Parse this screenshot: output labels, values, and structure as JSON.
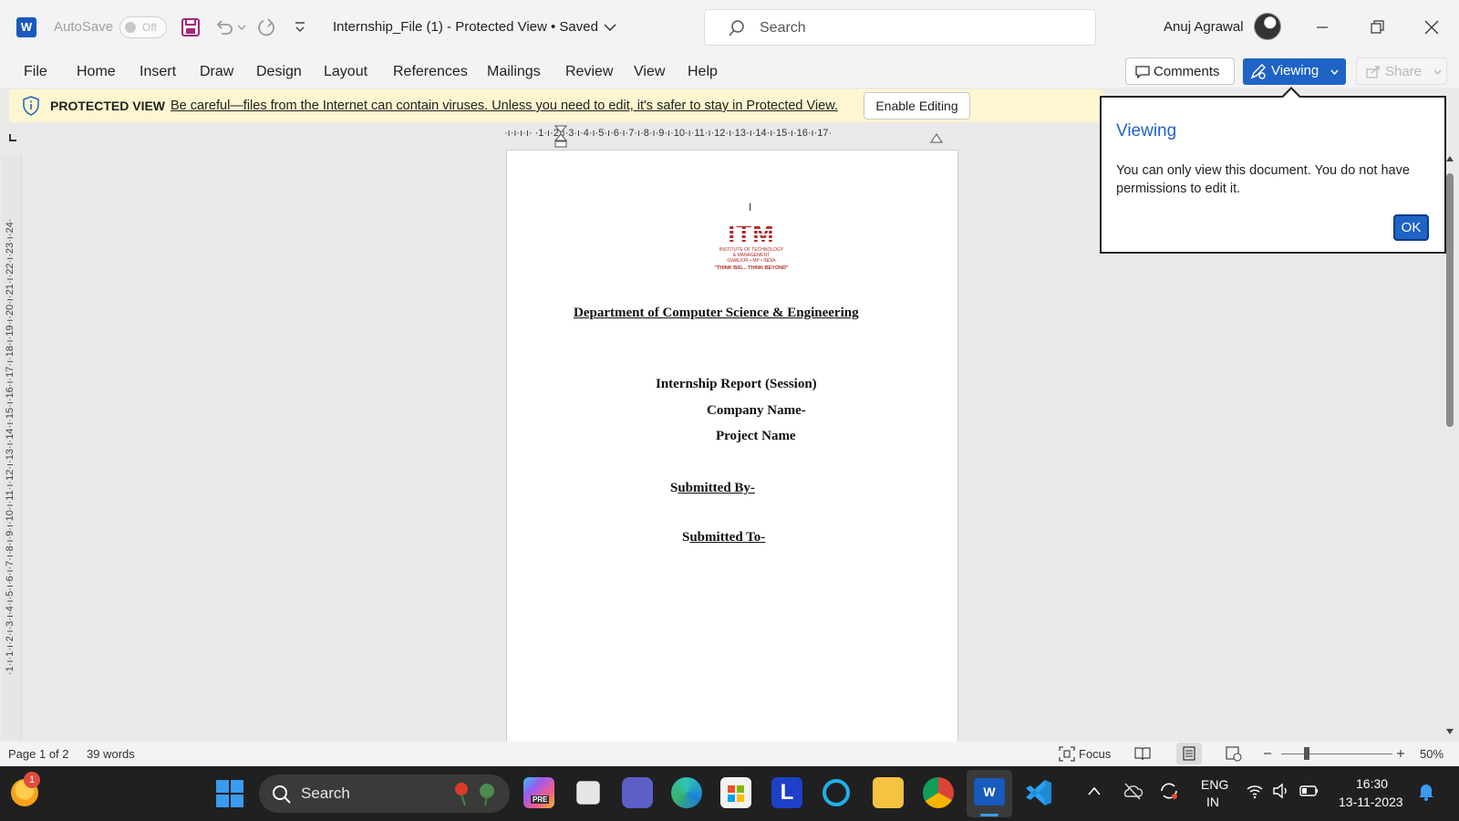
{
  "titlebar": {
    "app_icon": "word-icon",
    "autosave_label": "AutoSave",
    "autosave_state": "Off",
    "doc_title": "Internship_File (1)  -  Protected View • Saved",
    "search_placeholder": "Search",
    "user_name": "Anuj Agrawal"
  },
  "menu": {
    "items": [
      "File",
      "Home",
      "Insert",
      "Draw",
      "Design",
      "Layout",
      "References",
      "Mailings",
      "Review",
      "View",
      "Help"
    ],
    "comments_label": "Comments",
    "viewing_label": "Viewing",
    "share_label": "Share"
  },
  "protected_view": {
    "label": "PROTECTED VIEW",
    "message": "Be careful—files from the Internet can contain viruses. Unless you need to edit, it's safer to stay in Protected View.",
    "enable_button": "Enable Editing"
  },
  "ruler": {
    "horizontal": "·ı·ı·ı·ı· ·1·ı·2·ı·3·ı·4·ı·5·ı·6·ı·7·ı·8·ı·9·ı·10·ı·11·ı·12·ı·13·ı·14·ı·15·ı·16·ı·17·",
    "vertical": "·1·ı·1·ı·2·ı·3·ı·4·ı·5·ı·6·ı·7·ı·8·ı·9·ı·10·ı·11·ı·12·ı·13·ı·14·ı·15·ı·16·ı·17·ı·18·ı·19·ı·20·ı·21·ı·22·ı·23·ı·24·"
  },
  "document": {
    "cursor_mark": "I",
    "logo_main": "ITM",
    "logo_sub1": "INSTITUTE OF TECHNOLOGY",
    "logo_sub2": "& MANAGEMENT",
    "logo_sub3": "GWALIOR • MP • INDIA",
    "logo_tagline": "\"THINK BIG... THINK BEYOND\"",
    "department": "Department of Computer Science & Engineering",
    "report_title": "Internship Report (Session)",
    "company": "Company Name-",
    "project": "Project Name",
    "submitted_by_s": "S",
    "submitted_by_rest": "ubmitted By-",
    "submitted_to_s": "S",
    "submitted_to_rest": "ubmitted To-"
  },
  "dialog": {
    "title": "Viewing",
    "text": "You can only view this document. You do not have permissions to edit it.",
    "ok": "OK"
  },
  "statusbar": {
    "page": "Page 1 of 2",
    "words": "39 words",
    "focus": "Focus",
    "zoom": "50%"
  },
  "taskbar": {
    "search_placeholder": "Search",
    "notification_count": "1",
    "lang_line1": "ENG",
    "lang_line2": "IN",
    "time": "16:30",
    "date": "13-11-2023"
  },
  "colors": {
    "accent": "#1f63c6",
    "protected_bar": "#fdf6d0",
    "logo_red": "#b22a2a",
    "taskbar": "#202020"
  }
}
